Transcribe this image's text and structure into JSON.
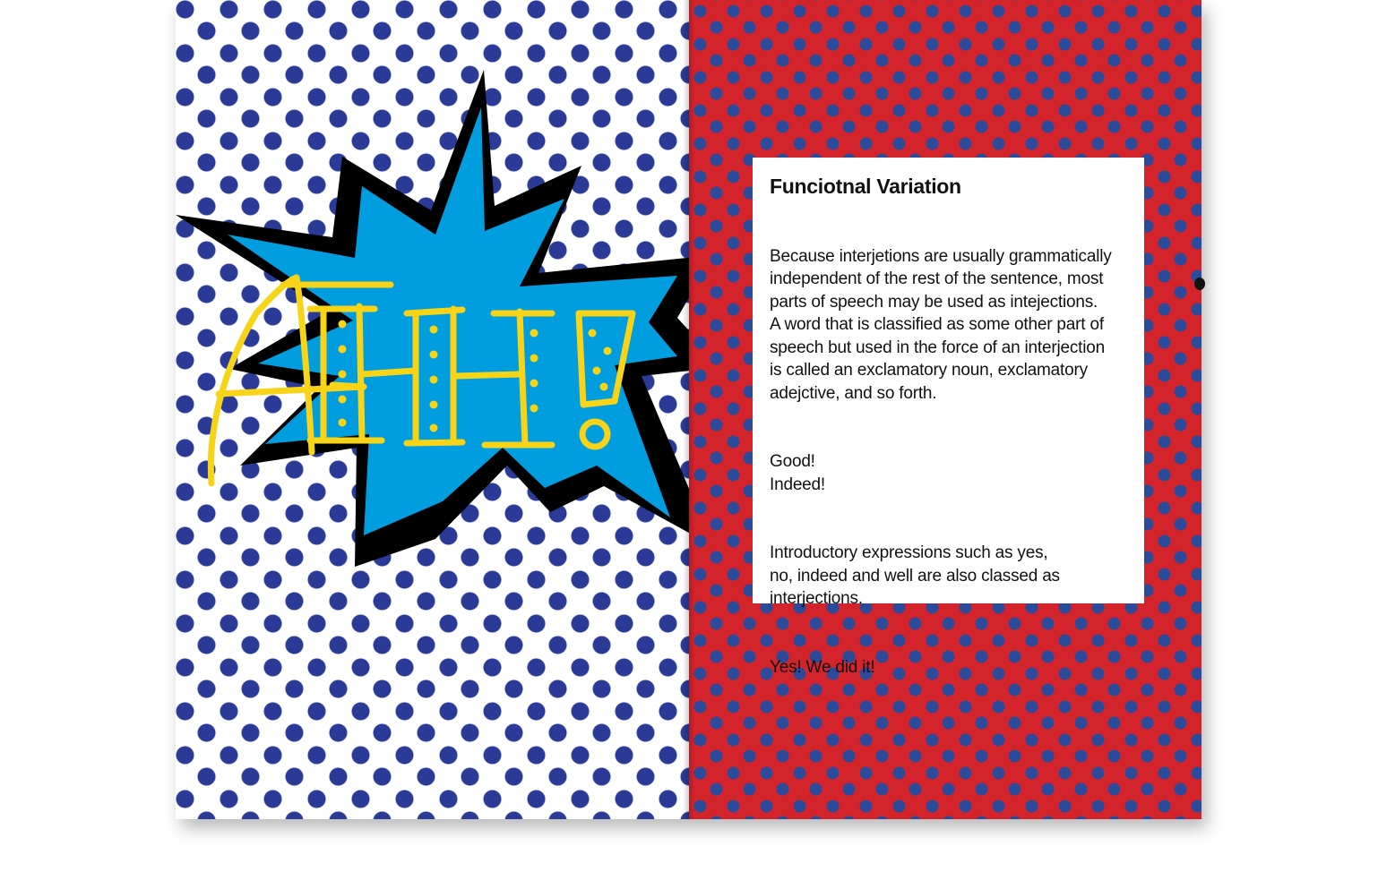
{
  "left_page": {
    "burst_text": "AHH!",
    "colors": {
      "dots": "#2a3a97",
      "burst_fill": "#009edf",
      "burst_outline": "#000000",
      "lettering": "#f7d417"
    }
  },
  "right_page": {
    "colors": {
      "background": "#d4242b",
      "dots": "#2b4a9a",
      "box": "#ffffff"
    },
    "title": "Funciotnal Variation",
    "paragraphs": [
      "Because interjetions are usually grammatically\nindependent of the rest of the sentence, most\nparts of speech may be used as intejections.\nA word that is classified as some other part of\nspeech but used in the force of an interjection\nis called an exclamatory noun, exclamatory\nadejctive, and so forth.",
      "Good!\nIndeed!",
      "Introductory expressions such as yes,\nno, indeed and well are also classed as\ninterjections.",
      "Yes! We did it!"
    ]
  }
}
